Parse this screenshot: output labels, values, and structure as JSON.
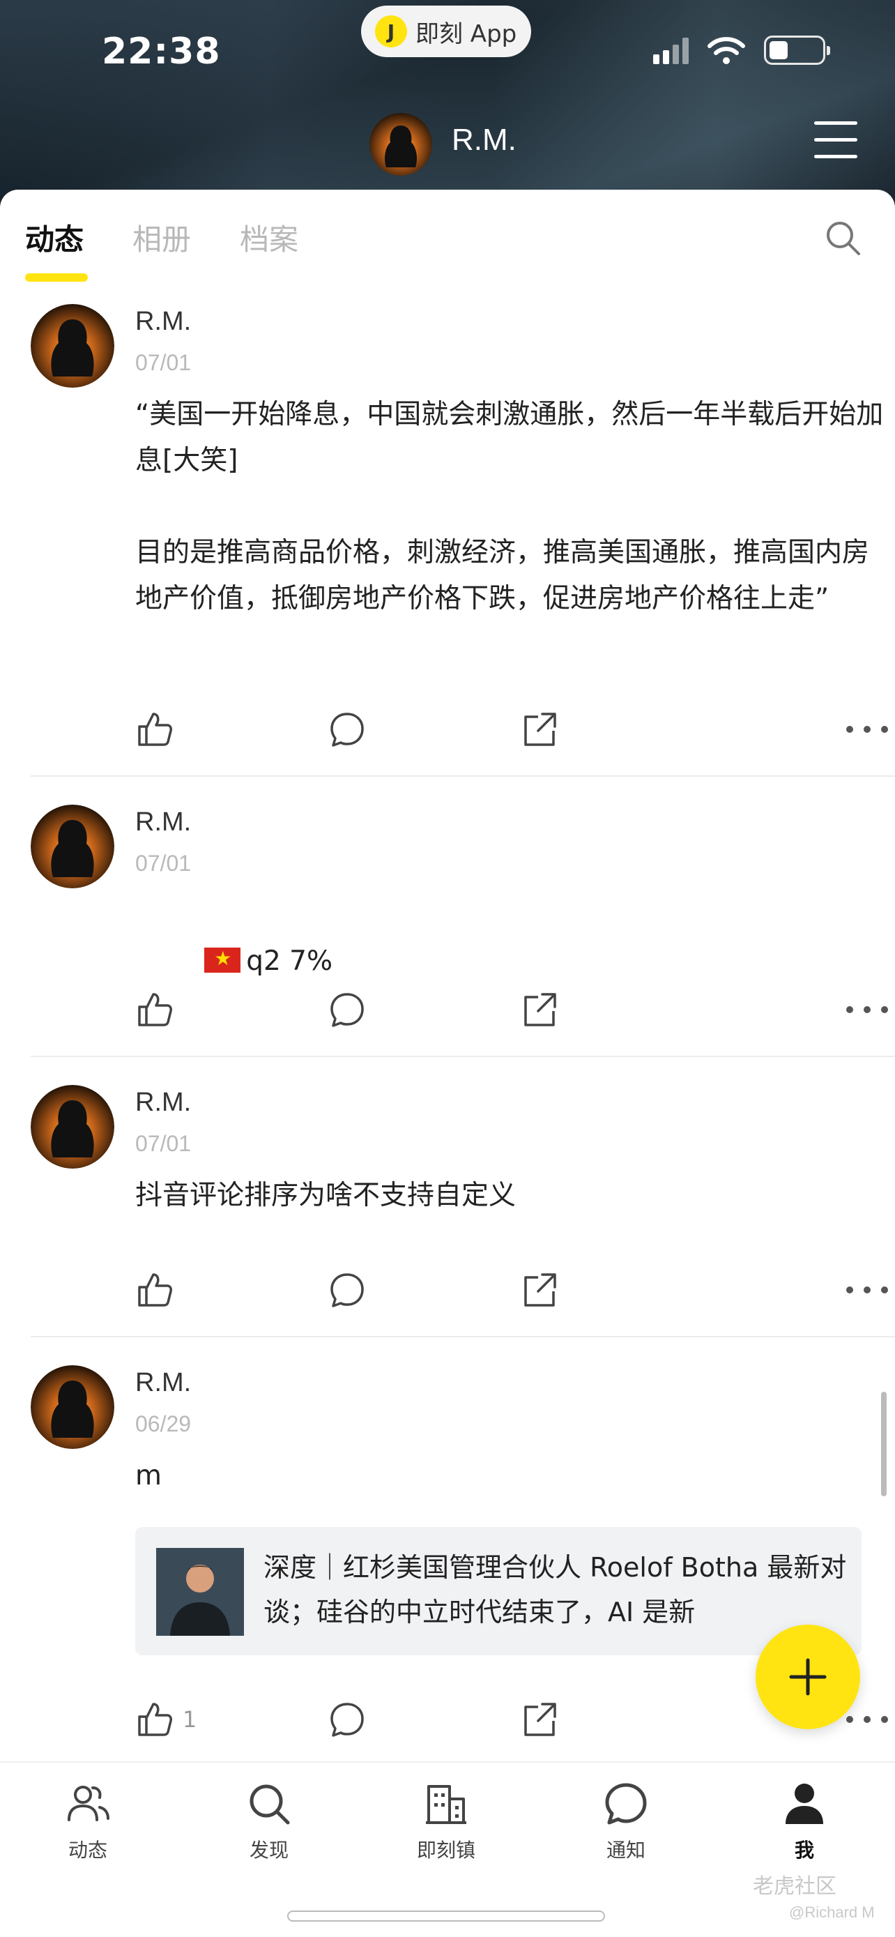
{
  "status_bar": {
    "time": "22:38",
    "app_pill": "即刻 App"
  },
  "header": {
    "profile_name": "R.M."
  },
  "tabs": [
    {
      "label": "动态",
      "active": true
    },
    {
      "label": "相册",
      "active": false
    },
    {
      "label": "档案",
      "active": false
    }
  ],
  "posts": [
    {
      "author": "R.M.",
      "date": "07/01",
      "text": "“美国一开始降息，中国就会刺激通胀，然后一年半载后开始加息[大笑]\n\n目的是推高商品价格，刺激经济，推高美国通胀，推高国内房地产价值，抵御房地产价格下跌，促进房地产价格往上走”"
    },
    {
      "author": "R.M.",
      "date": "07/01",
      "text": "q2 7%",
      "flag": "vietnam-flag-icon"
    },
    {
      "author": "R.M.",
      "date": "07/01",
      "text": "抖音评论排序为啥不支持自定义"
    },
    {
      "author": "R.M.",
      "date": "06/29",
      "text": "m",
      "link_card": {
        "title": "深度｜红杉美国管理合伙人 Roelof  Botha 最新对谈；硅谷的中立时代结束了，AI 是新"
      },
      "like_count": "1"
    }
  ],
  "bottom_nav": [
    {
      "label": "动态",
      "icon": "users-icon"
    },
    {
      "label": "发现",
      "icon": "search-icon"
    },
    {
      "label": "即刻镇",
      "icon": "building-icon"
    },
    {
      "label": "通知",
      "icon": "chat-bubble-icon"
    },
    {
      "label": "我",
      "icon": "person-icon",
      "active": true
    }
  ],
  "watermark": {
    "main": "老虎社区",
    "sub": "@Richard M"
  },
  "colors": {
    "accent": "#ffe411",
    "header_bg": "#1d2a33"
  }
}
